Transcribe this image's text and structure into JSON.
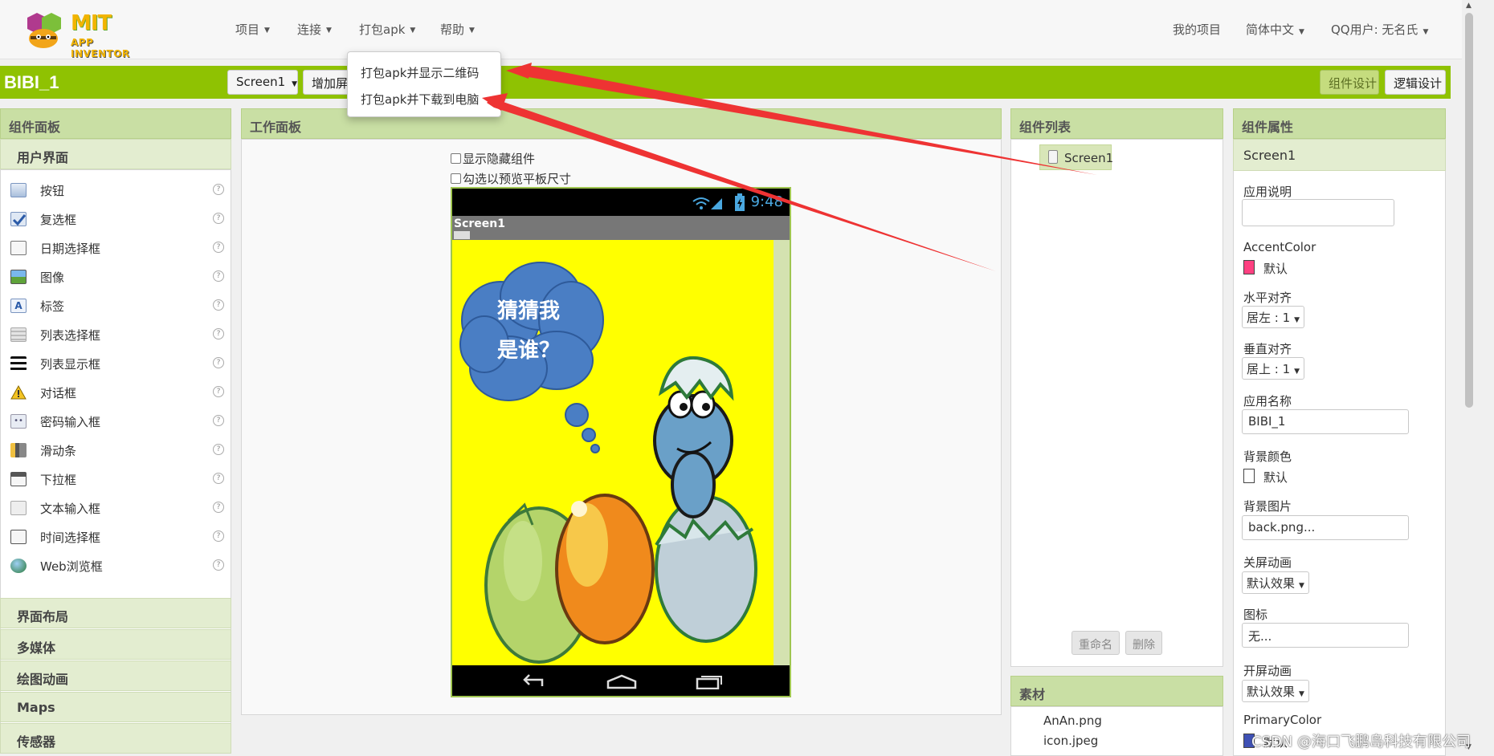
{
  "header": {
    "logo_main": "MIT",
    "logo_sub": "APP INVENTOR",
    "menus": [
      "项目",
      "连接",
      "打包apk",
      "帮助"
    ],
    "my_projects": "我的项目",
    "language": "简体中文",
    "user": "QQ用户: 无名氏"
  },
  "toolbar": {
    "project_name": "BIBI_1",
    "screen_select": "Screen1",
    "add_screen": "增加屏幕",
    "designer": "组件设计",
    "blocks": "逻辑设计"
  },
  "build_menu": {
    "items": [
      "打包apk并显示二维码",
      "打包apk并下载到电脑"
    ]
  },
  "palette": {
    "title": "组件面板",
    "user_interface": "用户界面",
    "items": [
      "按钮",
      "复选框",
      "日期选择框",
      "图像",
      "标签",
      "列表选择框",
      "列表显示框",
      "对话框",
      "密码输入框",
      "滑动条",
      "下拉框",
      "文本输入框",
      "时间选择框",
      "Web浏览框"
    ],
    "help_glyph": "?",
    "categories": [
      "界面布局",
      "多媒体",
      "绘图动画",
      "Maps",
      "传感器"
    ]
  },
  "viewer": {
    "title": "工作面板",
    "show_hidden": "显示隐藏组件",
    "tablet_preview": "勾选以预览平板尺寸",
    "clock": "9:48",
    "screen_title": "Screen1",
    "bubble_line1": "猜猜我",
    "bubble_line2": "是谁？"
  },
  "components": {
    "title": "组件列表",
    "tree_item": "Screen1",
    "rename": "重命名",
    "delete": "删除"
  },
  "media": {
    "title": "素材",
    "files": [
      "AnAn.png",
      "icon.jpeg"
    ]
  },
  "properties": {
    "title": "组件属性",
    "component": "Screen1",
    "about_label": "应用说明",
    "accent_label": "AccentColor",
    "accent_value": "默认",
    "halign_label": "水平对齐",
    "halign_value": "居左 : 1",
    "valign_label": "垂直对齐",
    "valign_value": "居上 : 1",
    "appname_label": "应用名称",
    "appname_value": "BIBI_1",
    "bgcolor_label": "背景颜色",
    "bgcolor_value": "默认",
    "bgimage_label": "背景图片",
    "bgimage_value": "back.png...",
    "close_anim_label": "关屏动画",
    "close_anim_value": "默认效果",
    "icon_label": "图标",
    "icon_value": "无...",
    "open_anim_label": "开屏动画",
    "open_anim_value": "默认效果",
    "primary_label": "PrimaryColor",
    "primary_value": "默认"
  },
  "watermark": "CSDN @海口飞鹏岛科技有限公司",
  "colors": {
    "accent_green": "#8fc202",
    "accent_swatch": "#ff4081",
    "primary_swatch": "#3f51b5",
    "arrow_red": "#ee3333"
  }
}
